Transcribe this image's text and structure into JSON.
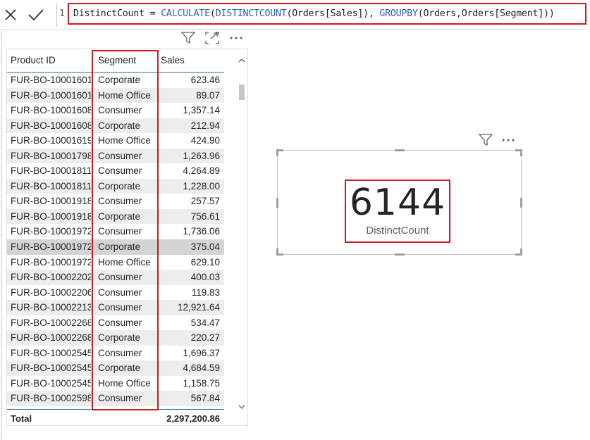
{
  "formula_bar": {
    "line_number": "1",
    "tokens": {
      "measure": "DistinctCount",
      "eq": " = ",
      "fn_calculate": "CALCULATE",
      "p1": "(",
      "fn_distinctcount": "DISTINCTCOUNT",
      "p2": "(",
      "ref_sales": "Orders[Sales]",
      "p3": "), ",
      "fn_groupby": "GROUPBY",
      "p4": "(",
      "ref_orders": "Orders,Orders[Segment]",
      "p5": "))"
    }
  },
  "table": {
    "columns": [
      "Product ID",
      "Segment",
      "Sales"
    ],
    "rows": [
      [
        "FUR-BO-10001601",
        "Corporate",
        "623.46"
      ],
      [
        "FUR-BO-10001601",
        "Home Office",
        "89.07"
      ],
      [
        "FUR-BO-10001608",
        "Consumer",
        "1,357.14"
      ],
      [
        "FUR-BO-10001608",
        "Corporate",
        "212.94"
      ],
      [
        "FUR-BO-10001619",
        "Home Office",
        "424.90"
      ],
      [
        "FUR-BO-10001798",
        "Consumer",
        "1,263.96"
      ],
      [
        "FUR-BO-10001811",
        "Consumer",
        "4,264.89"
      ],
      [
        "FUR-BO-10001811",
        "Corporate",
        "1,228.00"
      ],
      [
        "FUR-BO-10001918",
        "Consumer",
        "257.57"
      ],
      [
        "FUR-BO-10001918",
        "Corporate",
        "756.61"
      ],
      [
        "FUR-BO-10001972",
        "Consumer",
        "1,736.06"
      ],
      [
        "FUR-BO-10001972",
        "Corporate",
        "375.04"
      ],
      [
        "FUR-BO-10001972",
        "Home Office",
        "629.10"
      ],
      [
        "FUR-BO-10002202",
        "Consumer",
        "400.03"
      ],
      [
        "FUR-BO-10002206",
        "Consumer",
        "119.83"
      ],
      [
        "FUR-BO-10002213",
        "Consumer",
        "12,921.64"
      ],
      [
        "FUR-BO-10002268",
        "Consumer",
        "534.47"
      ],
      [
        "FUR-BO-10002268",
        "Corporate",
        "220.27"
      ],
      [
        "FUR-BO-10002545",
        "Consumer",
        "1,696.37"
      ],
      [
        "FUR-BO-10002545",
        "Corporate",
        "4,684.59"
      ],
      [
        "FUR-BO-10002545",
        "Home Office",
        "1,158.75"
      ],
      [
        "FUR-BO-10002598",
        "Consumer",
        "567.84"
      ]
    ],
    "selected_row": 11,
    "total_label": "Total",
    "total_value": "2,297,200.86"
  },
  "card": {
    "value": "6144",
    "label": "DistinctCount"
  },
  "icons": {
    "cancel": "close-icon",
    "commit": "checkmark-icon",
    "filter": "filter-icon",
    "focus": "focus-mode-icon",
    "more": "more-options-icon"
  },
  "colors": {
    "highlight": "#d0191c",
    "dax_function": "#2f63b0",
    "header_rule": "#2f6ea5"
  }
}
